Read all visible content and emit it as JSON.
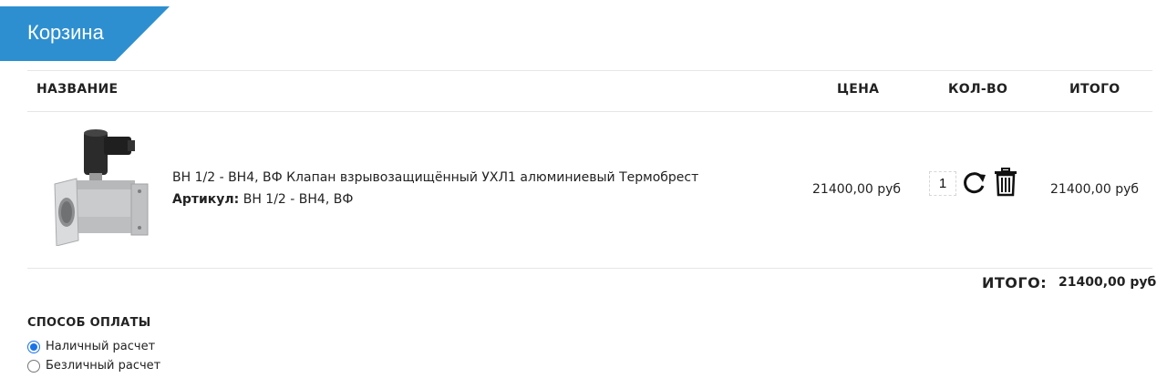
{
  "page": {
    "title": "Корзина",
    "accent_color": "#2e8fd0"
  },
  "table": {
    "headers": {
      "name": "НАЗВАНИЕ",
      "price": "ЦЕНА",
      "qty": "КОЛ-ВО",
      "total": "ИТОГО"
    }
  },
  "item": {
    "name": "ВН 1/2 - ВН4, ВФ Клапан взрывозащищённый УХЛ1 алюминиевый Термобрест",
    "sku_label": "Артикул:",
    "sku_value": "ВН 1/2 - ВН4, ВФ",
    "price": "21400,00 руб",
    "qty": "1",
    "line_total": "21400,00 руб",
    "image_icon": "gas-valve-product-image"
  },
  "summary": {
    "label": "ИТОГО:",
    "value": "21400,00 руб"
  },
  "payment": {
    "title": "СПОСОБ ОПЛАТЫ",
    "options": [
      {
        "label": "Наличный расчет",
        "checked": true
      },
      {
        "label": "Безличный расчет",
        "checked": false
      }
    ]
  }
}
